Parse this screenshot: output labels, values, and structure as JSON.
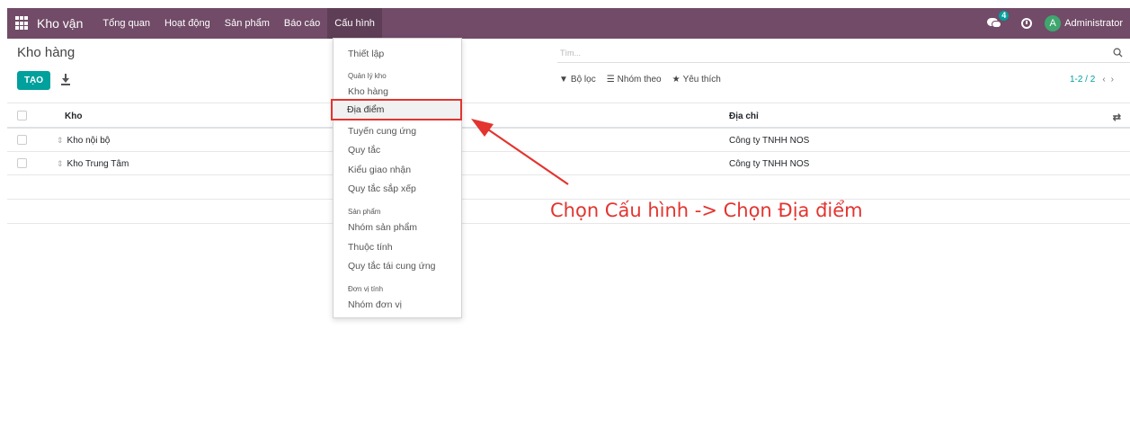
{
  "navbar": {
    "app_name": "Kho vận",
    "menu": [
      "Tổng quan",
      "Hoạt động",
      "Sản phẩm",
      "Báo cáo",
      "Cấu hình"
    ],
    "active_menu": "Cấu hình",
    "chat_count": "4",
    "avatar_letter": "A",
    "user": "Administrator",
    "colors": {
      "bar": "#714b67",
      "accent": "#00a09d",
      "avatar": "#3fa66f"
    }
  },
  "control_panel": {
    "breadcrumb": "Kho hàng",
    "create_label": "TẠO",
    "search_placeholder": "Tìm...",
    "filters": [
      "Bộ lọc",
      "Nhóm theo",
      "Yêu thích"
    ],
    "pager": "1-2 / 2"
  },
  "table": {
    "columns": {
      "name": "Kho",
      "address": "Địa chỉ"
    },
    "rows": [
      {
        "name": "Kho nội bộ",
        "address": "Công ty TNHH NOS"
      },
      {
        "name": "Kho Trung Tâm",
        "address": "Công ty TNHH NOS"
      }
    ]
  },
  "dropdown": {
    "setup": "Thiết lập",
    "sections": [
      {
        "header": "Quản lý kho",
        "items": [
          "Kho hàng",
          "Địa điểm",
          "Tuyến cung ứng",
          "Quy tắc",
          "Kiểu giao nhận",
          "Quy tắc sắp xếp"
        ]
      },
      {
        "header": "Sản phẩm",
        "items": [
          "Nhóm sản phẩm",
          "Thuộc tính",
          "Quy tắc tái cung ứng"
        ]
      },
      {
        "header": "Đơn vị tính",
        "items": [
          "Nhóm đơn vị"
        ]
      }
    ],
    "highlighted": "Địa điểm"
  },
  "annotation": {
    "text": "Chọn Cấu hình -> Chọn Địa điểm",
    "color": "#e3342f"
  }
}
